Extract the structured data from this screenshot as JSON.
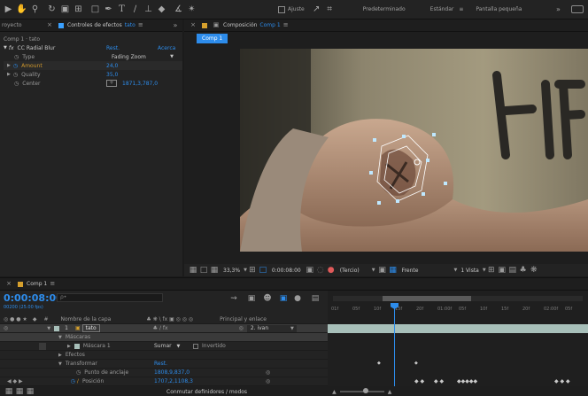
{
  "toolbar": {
    "snap_label": "Ajuste",
    "workspaces": [
      "Predeterminado",
      "Estándar",
      "Pantalla pequeña"
    ],
    "active_workspace_index": 1,
    "more_label": "»"
  },
  "effects_panel": {
    "project_tab": "royecto",
    "tab_label": "Controles de efectos",
    "tab_layer": "tato",
    "breadcrumb": "Comp 1 · tato",
    "effect_name": "CC Radial Blur",
    "reset_label": "Rest.",
    "about_label": "Acerca",
    "properties": [
      {
        "name": "Type",
        "value": "Fading Zoom",
        "has_dropdown": true
      },
      {
        "name": "Amount",
        "value": "24,0",
        "has_dropdown": false
      },
      {
        "name": "Quality",
        "value": "35,0",
        "has_dropdown": false
      },
      {
        "name": "Center",
        "value": "1871,3,787,0",
        "has_dropdown": false
      }
    ]
  },
  "comp_panel": {
    "tab_label": "Composición",
    "tab_comp": "Comp 1",
    "sub_tab": "Comp 1",
    "zoom": "33,3%",
    "timecode": "0:00:08:00",
    "resolution": "(Tercio)",
    "view": "Frente",
    "views": "1 Vista"
  },
  "timeline": {
    "tab_label": "Comp 1",
    "timecode": "0:00:08:00",
    "frames_info": "00200 (25.00 fps)",
    "search_placeholder": "ρ•",
    "columns": {
      "layer_name": "Nombre de la capa",
      "parent": "Principal y enlace"
    },
    "layer": {
      "index": "1",
      "name": "tato",
      "parent": "2. ivan"
    },
    "rows": [
      {
        "label": "Máscaras",
        "value": "",
        "indent": 1,
        "highlight": true
      },
      {
        "label": "Máscara 1",
        "value": "Sumar",
        "extra": "Invertido",
        "indent": 2,
        "highlight": false
      },
      {
        "label": "Efectos",
        "value": "",
        "indent": 1,
        "highlight": false
      },
      {
        "label": "Transformar",
        "value": "Rest.",
        "indent": 1,
        "highlight": false
      },
      {
        "label": "Punto de anclaje",
        "value": "1808,9,837,0",
        "indent": 3,
        "highlight": false
      },
      {
        "label": "Posición",
        "value": "1707,2,1108,3",
        "indent": 3,
        "highlight": false
      }
    ],
    "ruler_ticks": [
      "01f",
      "05f",
      "10f",
      "15f",
      "20f",
      "01:00f",
      "05f",
      "10f",
      "15f",
      "20f",
      "02:00f",
      "05f"
    ],
    "footer_label": "Conmutar definidores / modos"
  },
  "colors": {
    "accent": "#2d8ceb",
    "panel": "#232323",
    "layer_bar": "#a7bfb9",
    "playhead": "#2d8ceb"
  }
}
